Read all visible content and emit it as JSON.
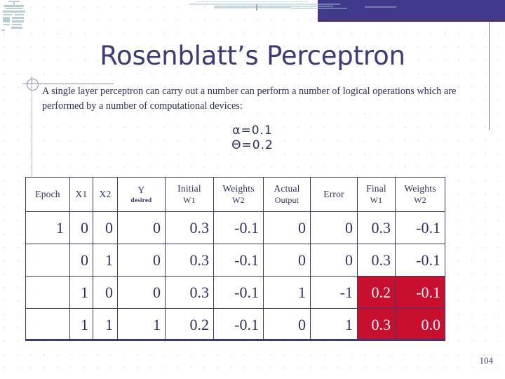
{
  "slide": {
    "title": "Rosenblatt’s Perceptron",
    "page_number": "104",
    "accent_purple": "#413a8c",
    "text_navy": "#2e2e63",
    "highlight_red": "#c8102e"
  },
  "body": {
    "paragraph": "A single layer perceptron can carry out a number can perform a number of logical operations which are performed by a number of computational devices:"
  },
  "formulas": {
    "alpha": "α=0.1",
    "theta": "Θ=0.2"
  },
  "table": {
    "headers": [
      {
        "line1": "Epoch",
        "line2": ""
      },
      {
        "line1": "X1",
        "line2": ""
      },
      {
        "line1": "X2",
        "line2": ""
      },
      {
        "line1": "Y",
        "line2": "desired"
      },
      {
        "line1": "Initial",
        "line2": "W1"
      },
      {
        "line1": "Weights",
        "line2": "W2"
      },
      {
        "line1": "Actual",
        "line2": "Output"
      },
      {
        "line1": "Error",
        "line2": ""
      },
      {
        "line1": "Final",
        "line2": "W1"
      },
      {
        "line1": "Weights",
        "line2": "W2"
      }
    ],
    "rows": [
      {
        "cells": [
          "1",
          "0",
          "0",
          "0",
          "0.3",
          "-0.1",
          "0",
          "0",
          "0.3",
          "-0.1"
        ],
        "highlight": [
          false,
          false,
          false,
          false,
          false,
          false,
          false,
          false,
          false,
          false
        ]
      },
      {
        "cells": [
          "",
          "0",
          "1",
          "0",
          "0.3",
          "-0.1",
          "0",
          "0",
          "0.3",
          "-0.1"
        ],
        "highlight": [
          false,
          false,
          false,
          false,
          false,
          false,
          false,
          false,
          false,
          false
        ]
      },
      {
        "cells": [
          "",
          "1",
          "0",
          "0",
          "0.3",
          "-0.1",
          "1",
          "-1",
          "0.2",
          "-0.1"
        ],
        "highlight": [
          false,
          false,
          false,
          false,
          false,
          false,
          false,
          false,
          true,
          true
        ]
      },
      {
        "cells": [
          "",
          "1",
          "1",
          "1",
          "0.2",
          "-0.1",
          "0",
          "1",
          "0.3",
          "0.0"
        ],
        "highlight": [
          false,
          false,
          false,
          false,
          false,
          false,
          false,
          false,
          true,
          true
        ]
      }
    ]
  }
}
